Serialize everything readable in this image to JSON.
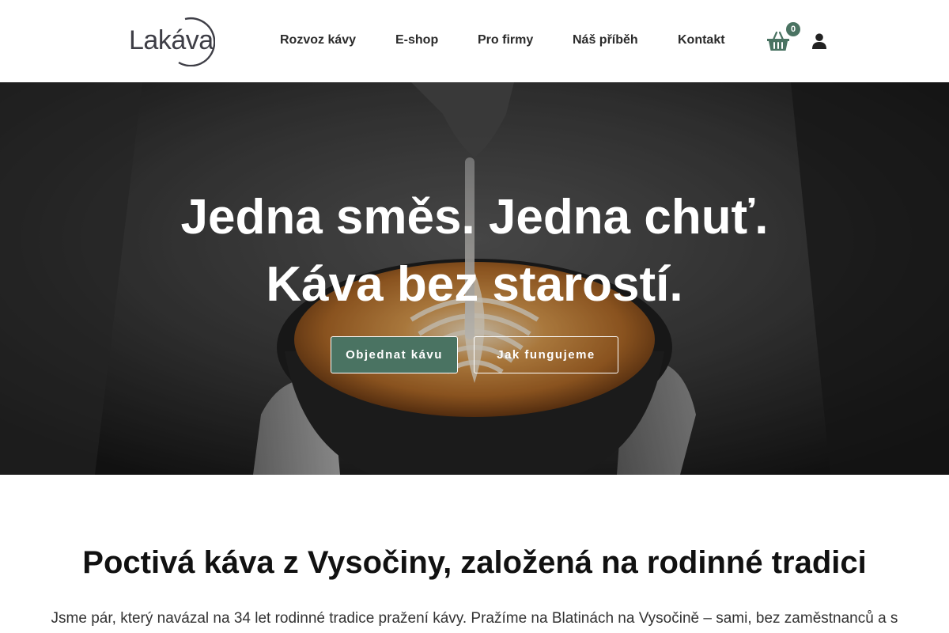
{
  "brand": {
    "logo_text": "Lakáva",
    "accent_color": "#4a7362"
  },
  "nav": {
    "items": [
      {
        "label": "Rozvoz kávy"
      },
      {
        "label": "E-shop"
      },
      {
        "label": "Pro firmy"
      },
      {
        "label": "Náš příběh"
      },
      {
        "label": "Kontakt"
      }
    ],
    "cart_icon": "basket-icon",
    "cart_count": "0",
    "user_icon": "user-icon"
  },
  "hero": {
    "title_line1": "Jedna směs. Jedna chuť.",
    "title_line2": "Káva bez starostí.",
    "primary_button": "Objednat kávu",
    "secondary_button": "Jak fungujeme",
    "background": "latte-art-photo"
  },
  "intro": {
    "title": "Poctivá káva z Vysočiny, založená na rodinné tradici",
    "text": "Jsme pár, který navázal na 34 let rodinné tradice pražení kávy. Pražíme na Blatinách na Vysočině – sami, bez zaměstnanců a s"
  }
}
